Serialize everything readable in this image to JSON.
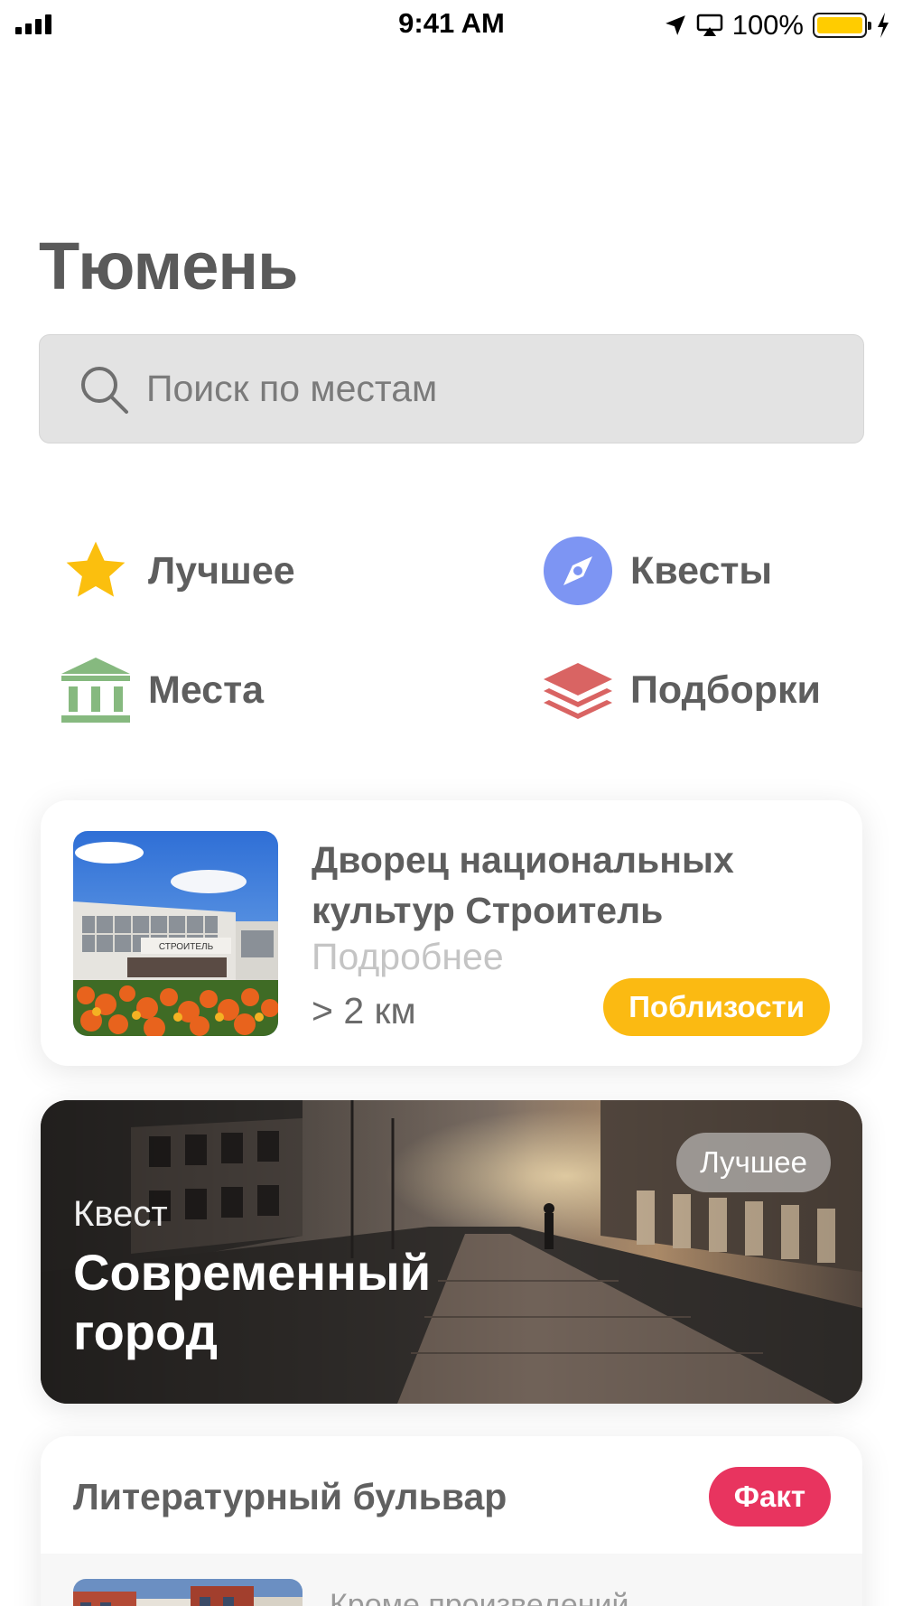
{
  "status_bar": {
    "time": "9:41 AM",
    "battery": "100%"
  },
  "header": {
    "title": "Тюмень"
  },
  "search": {
    "placeholder": "Поиск по местам"
  },
  "categories": [
    {
      "label": "Лучшее",
      "icon": "star-icon",
      "color": "#fbbf0e"
    },
    {
      "label": "Квесты",
      "icon": "compass-icon",
      "color": "#7d95f3"
    },
    {
      "label": "Места",
      "icon": "museum-icon",
      "color": "#86b97f"
    },
    {
      "label": "Подборки",
      "icon": "layers-icon",
      "color": "#d96463"
    }
  ],
  "place_card": {
    "title": "Дворец национальных культур Строитель",
    "more": "Подробнее",
    "distance": "> 2 км",
    "badge": "Поблизости",
    "sign_text": "СТРОИТЕЛЬ"
  },
  "quest_card": {
    "kind": "Квест",
    "title": "Современный город",
    "badge": "Лучшее"
  },
  "fact_card": {
    "title": "Литературный бульвар",
    "badge": "Факт",
    "text": "Кроме произведений"
  },
  "colors": {
    "accent_yellow": "#fbba12",
    "fact_red": "#e8345f",
    "title_gray": "#5a5a5a"
  }
}
